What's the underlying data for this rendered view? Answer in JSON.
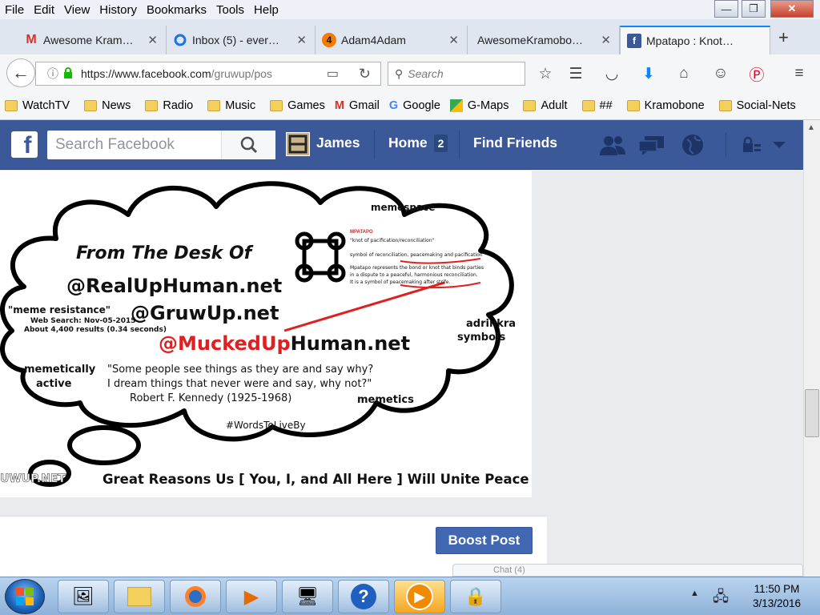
{
  "menubar": {
    "items": [
      "File",
      "Edit",
      "View",
      "History",
      "Bookmarks",
      "Tools",
      "Help"
    ]
  },
  "window_controls": {
    "minimize": "—",
    "maximize": "❐",
    "close": "✕"
  },
  "tabs": [
    {
      "label": "Awesome Kram…",
      "icon": "gmail-icon"
    },
    {
      "label": "Inbox (5) - ever…",
      "icon": "outlook-icon"
    },
    {
      "label": "Adam4Adam",
      "icon": "adam4adam-icon"
    },
    {
      "label": "AwesomeKramobo…",
      "icon": "blank-page-icon"
    },
    {
      "label": "Mpatapo : Knot…",
      "icon": "facebook-icon",
      "active": true
    }
  ],
  "navbar": {
    "url_host": "https://www.facebook.com",
    "url_path": "/gruwup/pos",
    "search_placeholder": "Search"
  },
  "bookmarks": [
    {
      "label": "WatchTV",
      "icon": "folder"
    },
    {
      "label": "News",
      "icon": "folder"
    },
    {
      "label": "Radio",
      "icon": "folder"
    },
    {
      "label": "Music",
      "icon": "folder"
    },
    {
      "label": "Games",
      "icon": "folder"
    },
    {
      "label": "Gmail",
      "icon": "gmail"
    },
    {
      "label": "Google",
      "icon": "google"
    },
    {
      "label": "G-Maps",
      "icon": "maps"
    },
    {
      "label": "Adult",
      "icon": "folder"
    },
    {
      "label": "##",
      "icon": "folder"
    },
    {
      "label": "Kramobone",
      "icon": "folder"
    },
    {
      "label": "Social-Nets",
      "icon": "folder"
    }
  ],
  "facebook": {
    "search_placeholder": "Search Facebook",
    "user_name": "James",
    "home_label": "Home",
    "home_count": "2",
    "find_friends_label": "Find Friends"
  },
  "post_image": {
    "desk_of": "From The Desk Of",
    "site1": "@RealUpHuman.net",
    "site2": "@GruwUp.net",
    "site3_red": "@MuckedUp",
    "site3_black": "Human.net",
    "meme_resistance": "\"meme resistance\"",
    "web_search": "Web Search: Nov-05-2015",
    "results": "About 4,400 results (0.34 seconds)",
    "memespace": "memespace",
    "adrinkra": "adrinkra",
    "symbols": "symbols",
    "memetically": "memetically",
    "active": "active",
    "memetics": "memetics",
    "quote1": "\"Some people see things as they are and say why?",
    "quote2": "I dream things that never were and say, why not?\"",
    "quote_author": "Robert F. Kennedy (1925-1968)",
    "hashtag": "#WordsToLiveBy",
    "mpatapo_title": "MPATAPO",
    "mpatapo_sub": "\"knot of pacification/reconciliation\"",
    "mpatapo_line1": "symbol of reconciliation, peacemaking and pacification",
    "mpatapo_line2": "Mpatapo represents the bond or knot that binds parties",
    "mpatapo_line3": "in a dispute to a peaceful, harmonious reconciliation.",
    "mpatapo_line4": "It is a symbol of peacemaking after strife.",
    "watermark": "UWUP.NET",
    "caption": "Great Reasons Us [ You, I, and All Here ] Will Unite Peace"
  },
  "boost_label": "Boost Post",
  "chat_stub": "Chat (4)",
  "clock": {
    "time": "11:50 PM",
    "date": "3/13/2016"
  },
  "colors": {
    "facebook_blue": "#3b5998",
    "boost_blue": "#4267b2",
    "red_text": "#e02020"
  }
}
